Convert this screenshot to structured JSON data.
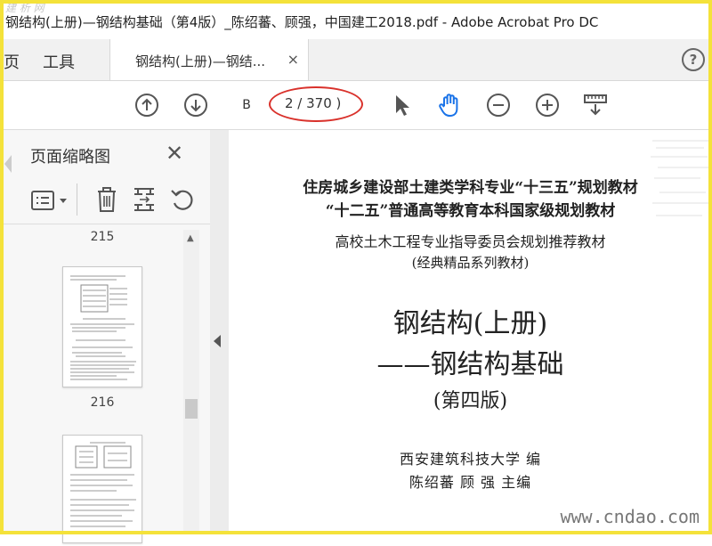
{
  "window": {
    "title": "钢结构(上册)—钢结构基础（第4版）_陈绍蕃、顾强，中国建工2018.pdf - Adobe Acrobat Pro DC",
    "watermark_top": "建 析 网"
  },
  "nav": {
    "home_fragment": "页",
    "tools": "工具",
    "doc_tab": "钢结构(上册)—钢结...",
    "doc_tab_close": "×",
    "help": "?"
  },
  "toolbar": {
    "page_input": "B",
    "page_count": "2 / 370 )",
    "icons": [
      "prev-page-icon",
      "next-page-icon",
      "select-cursor-icon",
      "hand-tool-icon",
      "zoom-out-icon",
      "zoom-in-icon",
      "page-display-icon"
    ]
  },
  "sidebar": {
    "title": "页面缩略图",
    "close": "✕",
    "thumbnails": [
      {
        "label": "215"
      },
      {
        "label": "216"
      }
    ]
  },
  "document": {
    "lines": [
      "住房城乡建设部土建类学科专业“十三五”规划教材",
      "“十二五”普通高等教育本科国家级规划教材",
      "高校土木工程专业指导委员会规划推荐教材",
      "(经典精品系列教材)",
      "钢结构(上册)",
      "——钢结构基础",
      "(第四版)",
      "西安建筑科技大学   编",
      "陈绍蕃   顾   强   主编"
    ]
  },
  "footer": {
    "watermark": "www.cndao.com"
  },
  "colors": {
    "accent_blue": "#1a73e8",
    "annotation_red": "#d9312b",
    "frame_yellow": "#f4e23a"
  }
}
